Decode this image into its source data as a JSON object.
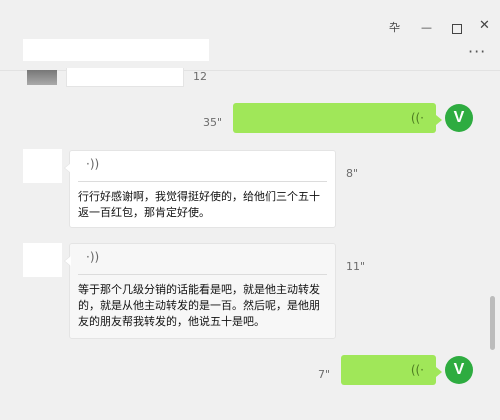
{
  "window": {
    "pin_glyph": "卆",
    "minimize_glyph": "—",
    "maximize_glyph": "",
    "close_glyph": "✕"
  },
  "header": {
    "more_label": "···"
  },
  "messages": [
    {
      "side": "left",
      "duration": "12"
    },
    {
      "side": "right",
      "duration": "35\""
    },
    {
      "side": "left",
      "duration": "8\"",
      "transcript": "行行好感谢啊，我觉得挺好使的，给他们三个五十返一百红包，那肯定好使。"
    },
    {
      "side": "left",
      "duration": "11\"",
      "transcript": "等于那个几级分销的话能看是吧，就是他主动转发的，就是从他主动转发的是一百。然后呢，是他朋友的朋友帮我转发的，他说五十是吧。"
    },
    {
      "side": "right",
      "duration": "7\""
    }
  ],
  "icons": {
    "voice_wave": "((·",
    "voice_wave_left": "·))",
    "logo_letter": "V"
  },
  "colors": {
    "sent_bubble": "#a0e759",
    "logo": "#2eac40",
    "background": "#f0f0f0"
  }
}
